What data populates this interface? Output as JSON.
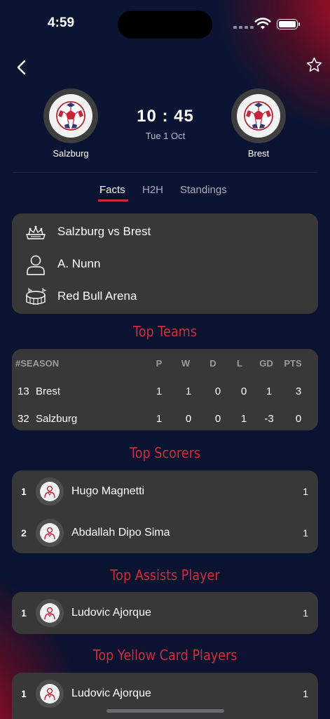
{
  "status_bar": {
    "time": "4:59"
  },
  "match": {
    "home_team": "Salzburg",
    "away_team": "Brest",
    "time": "10 : 45",
    "date": "Tue  1 Oct"
  },
  "tabs": [
    {
      "label": "Facts",
      "active": true
    },
    {
      "label": "H2H",
      "active": false
    },
    {
      "label": "Standings",
      "active": false
    }
  ],
  "info": {
    "fixture": "Salzburg vs Brest",
    "referee": "A. Nunn",
    "venue": "Red Bull Arena"
  },
  "sections": {
    "top_teams": "Top Teams",
    "top_scorers": "Top  Scorers",
    "top_assists": "Top Assists Player",
    "top_yellow": "Top Yellow Card Players"
  },
  "standings": {
    "headers": [
      "#SEASON",
      "P",
      "W",
      "D",
      "L",
      "GD",
      "PTS"
    ],
    "rows": [
      {
        "pos": "13",
        "team": "Brest",
        "p": "1",
        "w": "1",
        "d": "0",
        "l": "0",
        "gd": "1",
        "pts": "3"
      },
      {
        "pos": "32",
        "team": "Salzburg",
        "p": "1",
        "w": "0",
        "d": "0",
        "l": "1",
        "gd": "-3",
        "pts": "0"
      }
    ]
  },
  "top_scorers": [
    {
      "rank": "1",
      "name": "Hugo Magnetti",
      "count": "1"
    },
    {
      "rank": "2",
      "name": "Abdallah Dipo Sima",
      "count": "1"
    }
  ],
  "top_assists": [
    {
      "rank": "1",
      "name": "Ludovic Ajorque",
      "count": "1"
    }
  ],
  "top_yellow": [
    {
      "rank": "1",
      "name": "Ludovic Ajorque",
      "count": "1"
    }
  ],
  "colors": {
    "accent": "#d32a3c",
    "card": "#383838",
    "background": "#0b1533"
  }
}
